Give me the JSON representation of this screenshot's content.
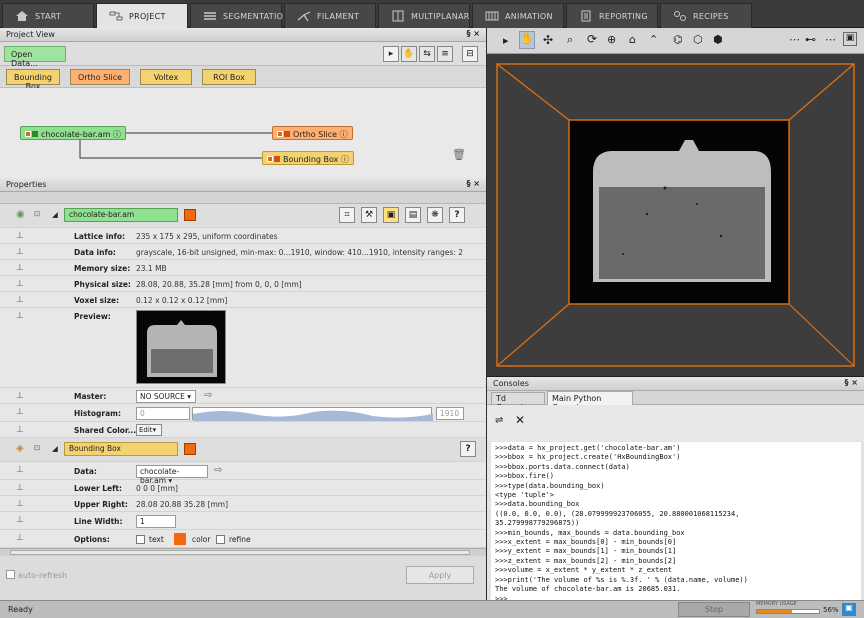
{
  "tabs": [
    {
      "label": "START",
      "icon": "home-icon"
    },
    {
      "label": "PROJECT",
      "icon": "project-icon"
    },
    {
      "label": "SEGMENTATION",
      "icon": "segmentation-icon"
    },
    {
      "label": "FILAMENT",
      "icon": "filament-icon"
    },
    {
      "label": "MULTIPLANAR",
      "icon": "multiplanar-icon"
    },
    {
      "label": "ANIMATION",
      "icon": "animation-icon"
    },
    {
      "label": "REPORTING",
      "icon": "reporting-icon"
    },
    {
      "label": "RECIPES",
      "icon": "recipes-icon"
    }
  ],
  "project_view": {
    "title": "Project View",
    "controls": "§ ×",
    "open_data": "Open Data...",
    "objects": [
      "Bounding Box",
      "Ortho Slice",
      "Voltex",
      "ROI Box"
    ],
    "nodes": {
      "data": "chocolate-bar.am",
      "ortho": "Ortho Slice",
      "bbox": "Bounding Box"
    }
  },
  "properties": {
    "title": "Properties",
    "controls": "§ ×",
    "data_module": {
      "name": "chocolate-bar.am",
      "lattice_label": "Lattice info:",
      "lattice_value": "235 x 175 x 295, uniform coordinates",
      "datainfo_label": "Data info:",
      "datainfo_value": "grayscale, 16-bit unsigned, min-max: 0...1910, window: 410...1910, intensity ranges: 2",
      "memory_label": "Memory size:",
      "memory_value": "23.1 MB",
      "physical_label": "Physical size:",
      "physical_value": "28.08, 20.88, 35.28 [mm] from 0, 0, 0 [mm]",
      "voxel_label": "Voxel size:",
      "voxel_value": "0.12 x 0.12 x 0.12 [mm]",
      "preview_label": "Preview:",
      "master_label": "Master:",
      "master_value": "NO SOURCE",
      "histogram_label": "Histogram:",
      "histogram_min": "0",
      "histogram_max": "1910",
      "shared_label": "Shared Color...",
      "edit_label": "Edit"
    },
    "bbox_module": {
      "name": "Bounding Box",
      "data_label": "Data:",
      "data_value": "chocolate-bar.am",
      "lower_label": "Lower Left:",
      "lower_value": "0 0 0 [mm]",
      "upper_label": "Upper Right:",
      "upper_value": "28.08 20.88 35.28 [mm]",
      "linewidth_label": "Line Width:",
      "linewidth_value": "1",
      "options_label": "Options:",
      "opt_text": "text",
      "opt_color": "color",
      "opt_refine": "refine"
    },
    "auto_refresh": "auto-refresh",
    "apply": "Apply"
  },
  "consoles": {
    "title": "Consoles",
    "tabs": [
      "Td Console",
      "Main Python Console"
    ],
    "lines": [
      ">>>data = hx_project.get('chocolate-bar.am')",
      ">>>bbox = hx_project.create('HxBoundingBox')",
      ">>>bbox.ports.data.connect(data)",
      ">>>bbox.fire()",
      ">>>type(data.bounding_box)",
      "<type 'tuple'>",
      ">>>data.bounding_box",
      "((0.0, 0.0, 0.0), (28.079999923706055, 20.880001068115234,",
      "35.279998779296875))",
      ">>>min_bounds, max_bounds = data.bounding_box",
      ">>>x_extent = max_bounds[0] - min_bounds[0]",
      ">>>y_extent = max_bounds[1] - min_bounds[1]",
      ">>>z_extent = max_bounds[2] - min_bounds[2]",
      ">>>volume = x_extent * y_extent * z_extent",
      ">>>print('The volume of %s is %.3f. ' % (data.name, volume))",
      "The volume of chocolate-bar.am is 20685.031.",
      ">>>"
    ]
  },
  "status": {
    "text": "Ready",
    "stop": "Stop",
    "memory_label": "MEMORY USAGE",
    "memory_value": "56%",
    "memory_fraction": 0.56
  },
  "colors": {
    "green_node": "#8fe08f",
    "orange_node": "#ffb070",
    "yellow_node": "#f5d270",
    "orange_accent": "#f06a10",
    "viewer_bbox": "#e07010"
  }
}
